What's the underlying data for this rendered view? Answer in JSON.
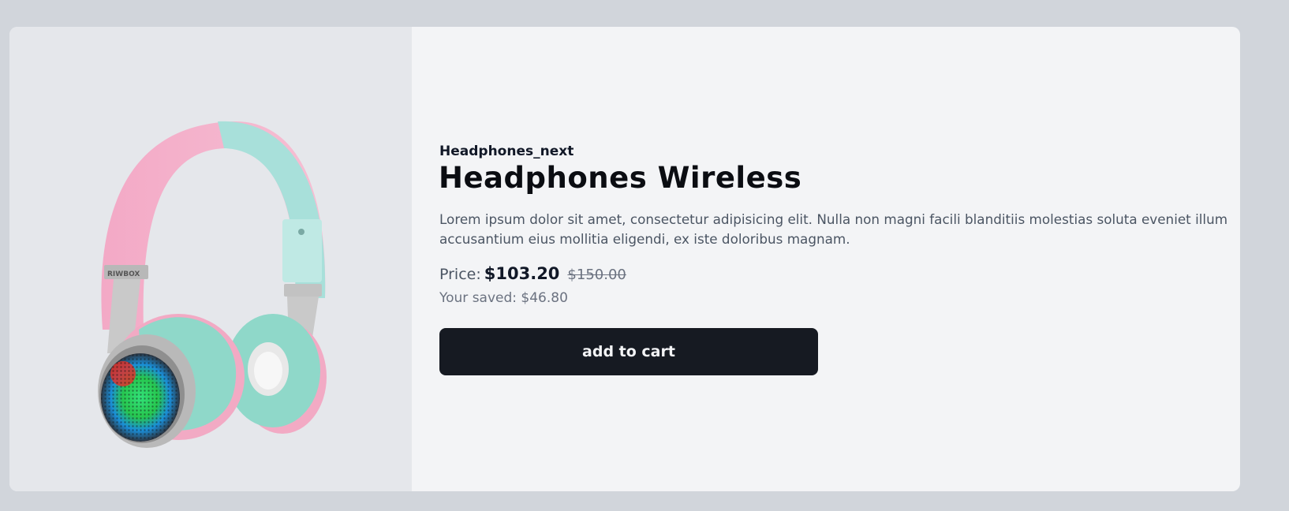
{
  "product": {
    "brand": "Headphones_next",
    "title": "Headphones Wireless",
    "description": "Lorem ipsum dolor sit amet, consectetur adipisicing elit. Nulla non magni facili blanditiis molestias soluta eveniet illum accusantium eius mollitia eligendi, ex iste doloribus magnam.",
    "price_label": "Price:",
    "price_current": "$103.20",
    "price_original": "$150.00",
    "saved_text": "Your saved: $46.80",
    "add_to_cart_label": "add to cart",
    "image_brand_text": "RIWBOX"
  },
  "colors": {
    "page_background": "#d1d5db",
    "card_background": "#f3f4f6",
    "image_background": "#e5e7eb",
    "button_background": "#161a22",
    "button_text": "#f3f4f6"
  },
  "icons": {
    "product_image": "pink-mint-headphones"
  }
}
